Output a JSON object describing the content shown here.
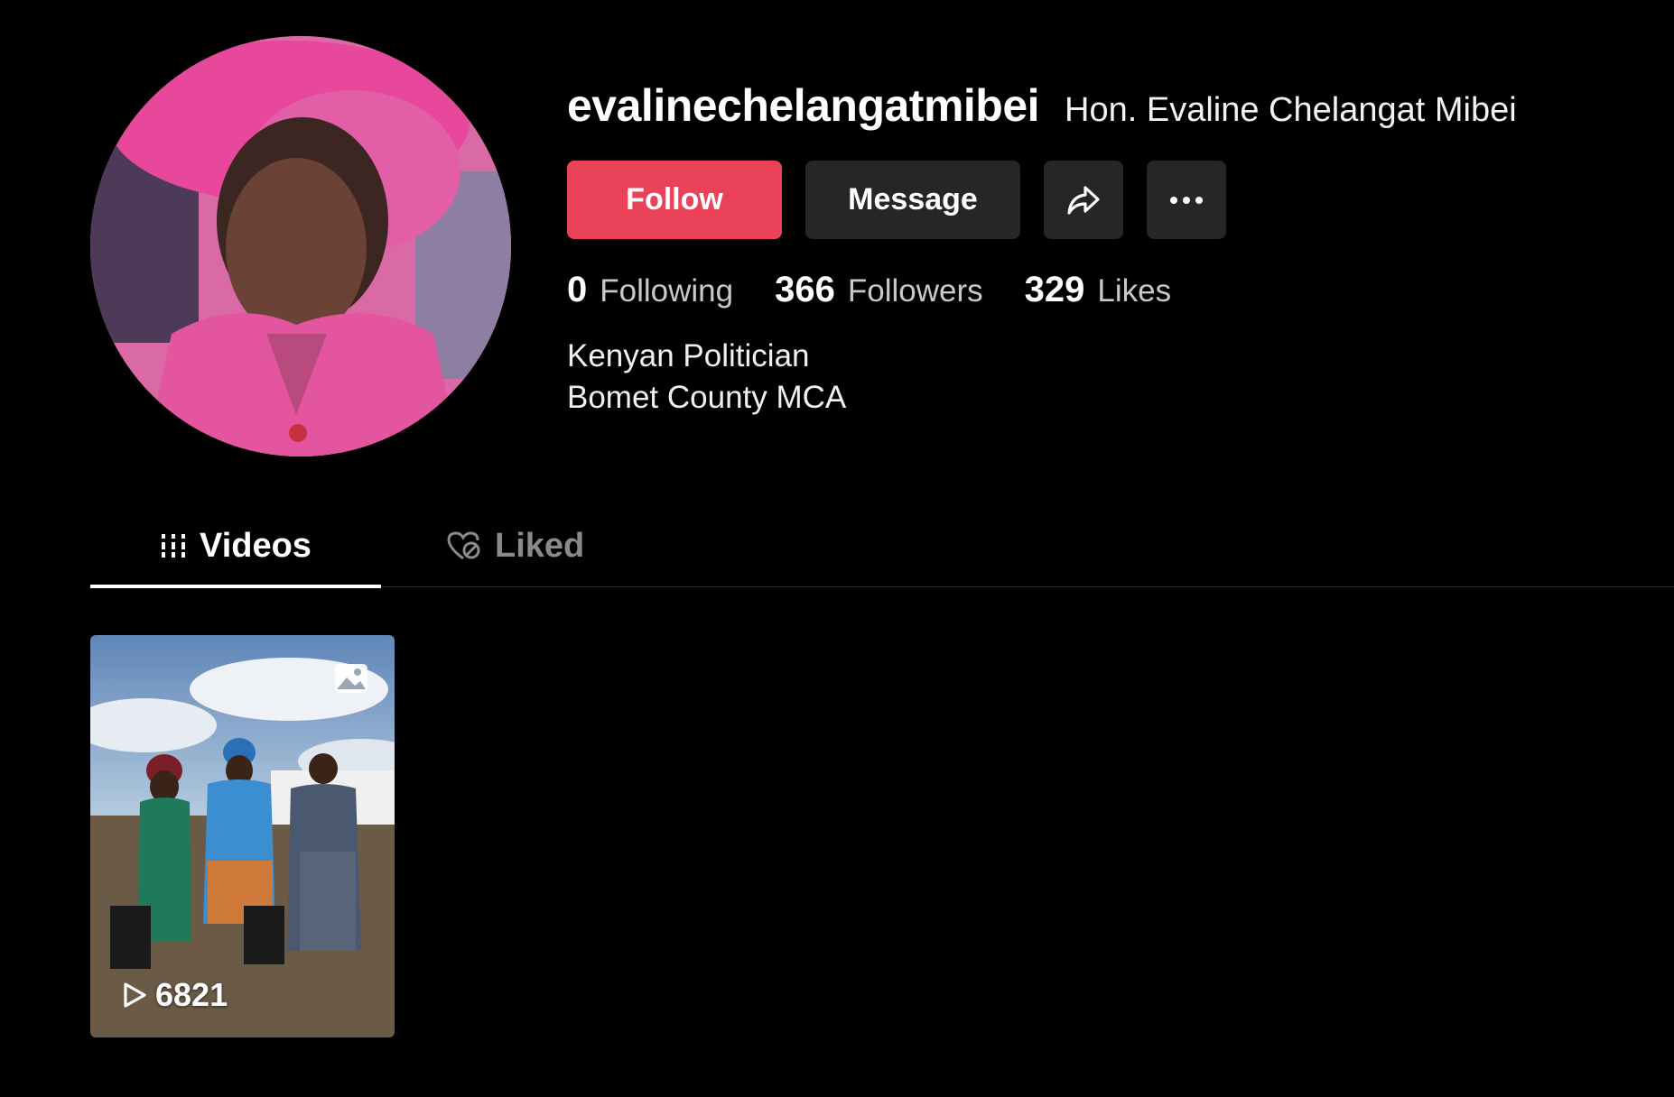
{
  "profile": {
    "username": "evalinechelangatmibei",
    "display_name": "Hon. Evaline Chelangat Mibei",
    "avatar_icon": "profile-photo"
  },
  "actions": {
    "follow_label": "Follow",
    "message_label": "Message",
    "share_icon": "share-arrow-icon",
    "more_icon": "ellipsis-icon"
  },
  "stats": {
    "following_count": "0",
    "following_label": "Following",
    "followers_count": "366",
    "followers_label": "Followers",
    "likes_count": "329",
    "likes_label": "Likes"
  },
  "bio": {
    "line1": "Kenyan Politician",
    "line2": "Bomet County MCA"
  },
  "tabs": [
    {
      "label": "Videos",
      "icon": "grid-icon",
      "active": true
    },
    {
      "label": "Liked",
      "icon": "heart-lock-icon",
      "active": false
    }
  ],
  "videos": [
    {
      "views": "6821",
      "type_icon": "photo-icon"
    }
  ],
  "colors": {
    "background": "#000000",
    "follow": "#ea4359",
    "button": "#262626",
    "muted_text": "#8a8a8a"
  }
}
